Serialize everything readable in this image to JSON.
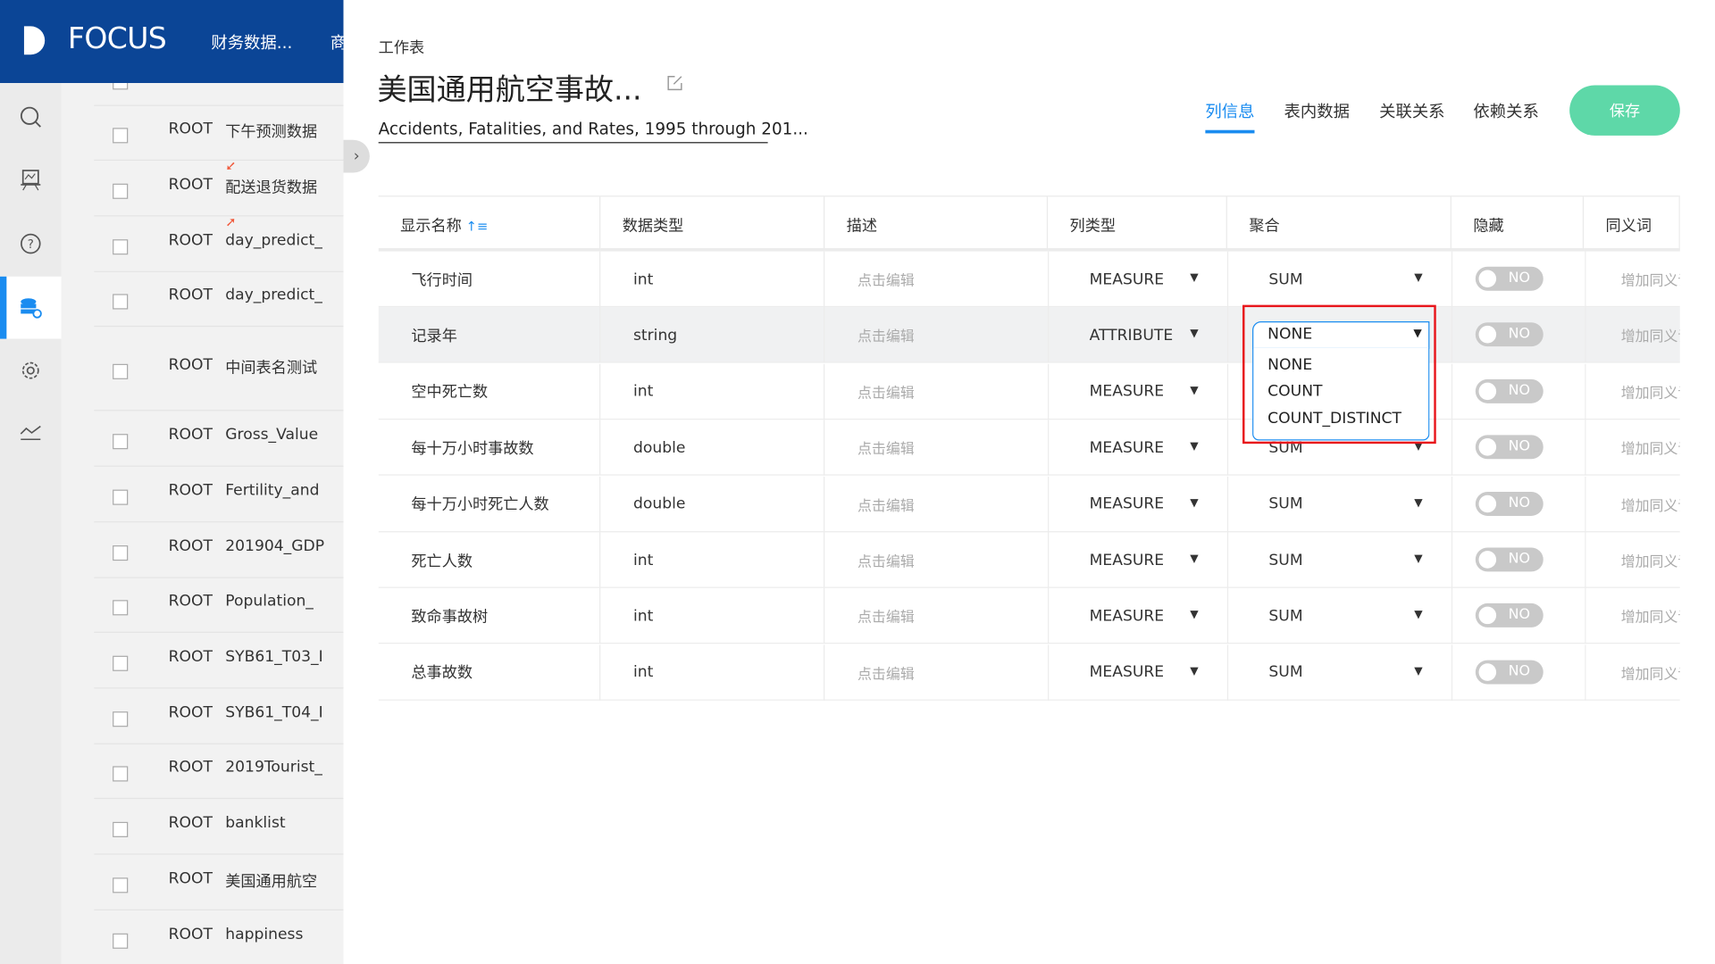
{
  "topbar": {
    "logo_text": "FOCUS",
    "nav": [
      "财务数据...",
      "商"
    ]
  },
  "sidebar": {
    "icons": [
      "search-icon",
      "presentation-icon",
      "help-icon",
      "database-settings-icon",
      "gear-icon",
      "trend-icon"
    ],
    "active": "database-settings-icon",
    "accent": "#1a8cf0"
  },
  "list": {
    "rows": [
      {
        "owner": "ROOT",
        "name": "下午预测数据"
      },
      {
        "owner": "ROOT",
        "name": "配送退货数据"
      },
      {
        "owner": "ROOT",
        "name": "day_predict_"
      },
      {
        "owner": "ROOT",
        "name": "day_predict_"
      },
      {
        "owner": "ROOT",
        "name": "中间表名测试"
      },
      {
        "owner": "ROOT",
        "name": "Gross_Value"
      },
      {
        "owner": "ROOT",
        "name": "Fertility_and"
      },
      {
        "owner": "ROOT",
        "name": "201904_GDP"
      },
      {
        "owner": "ROOT",
        "name": "Population_"
      },
      {
        "owner": "ROOT",
        "name": "SYB61_T03_I"
      },
      {
        "owner": "ROOT",
        "name": "SYB61_T04_I"
      },
      {
        "owner": "ROOT",
        "name": "2019Tourist_"
      },
      {
        "owner": "ROOT",
        "name": "banklist"
      },
      {
        "owner": "ROOT",
        "name": "美国通用航空"
      },
      {
        "owner": "ROOT",
        "name": "happiness"
      }
    ]
  },
  "main": {
    "breadcrumb": "工作表",
    "title": "美国通用航空事故...",
    "description": "Accidents, Fatalities, and Rates, 1995 through 201...",
    "tabs": [
      "列信息",
      "表内数据",
      "关联关系",
      "依赖关系"
    ],
    "active_tab": "列信息",
    "save_label": "保存",
    "save_color": "#5ed8a8",
    "headers": [
      "显示名称",
      "数据类型",
      "描述",
      "列类型",
      "聚合",
      "隐藏",
      "同义词"
    ],
    "placeholder_desc": "点击编辑",
    "placeholder_syn": "增加同义词",
    "toggle_label": "NO",
    "rows": [
      {
        "name": "飞行时间",
        "type": "int",
        "coltype": "MEASURE",
        "agg": "SUM"
      },
      {
        "name": "记录年",
        "type": "string",
        "coltype": "ATTRIBUTE",
        "agg": "NONE"
      },
      {
        "name": "空中死亡数",
        "type": "int",
        "coltype": "MEASURE",
        "agg": "SUM"
      },
      {
        "name": "每十万小时事故数",
        "type": "double",
        "coltype": "MEASURE",
        "agg": "SUM"
      },
      {
        "name": "每十万小时死亡人数",
        "type": "double",
        "coltype": "MEASURE",
        "agg": "SUM"
      },
      {
        "name": "死亡人数",
        "type": "int",
        "coltype": "MEASURE",
        "agg": "SUM"
      },
      {
        "name": "致命事故树",
        "type": "int",
        "coltype": "MEASURE",
        "agg": "SUM"
      },
      {
        "name": "总事故数",
        "type": "int",
        "coltype": "MEASURE",
        "agg": "SUM"
      }
    ],
    "dropdown": {
      "selected": "NONE",
      "options": [
        "NONE",
        "COUNT",
        "COUNT_DISTINCT"
      ],
      "highlight_color": "#e8161c"
    }
  }
}
